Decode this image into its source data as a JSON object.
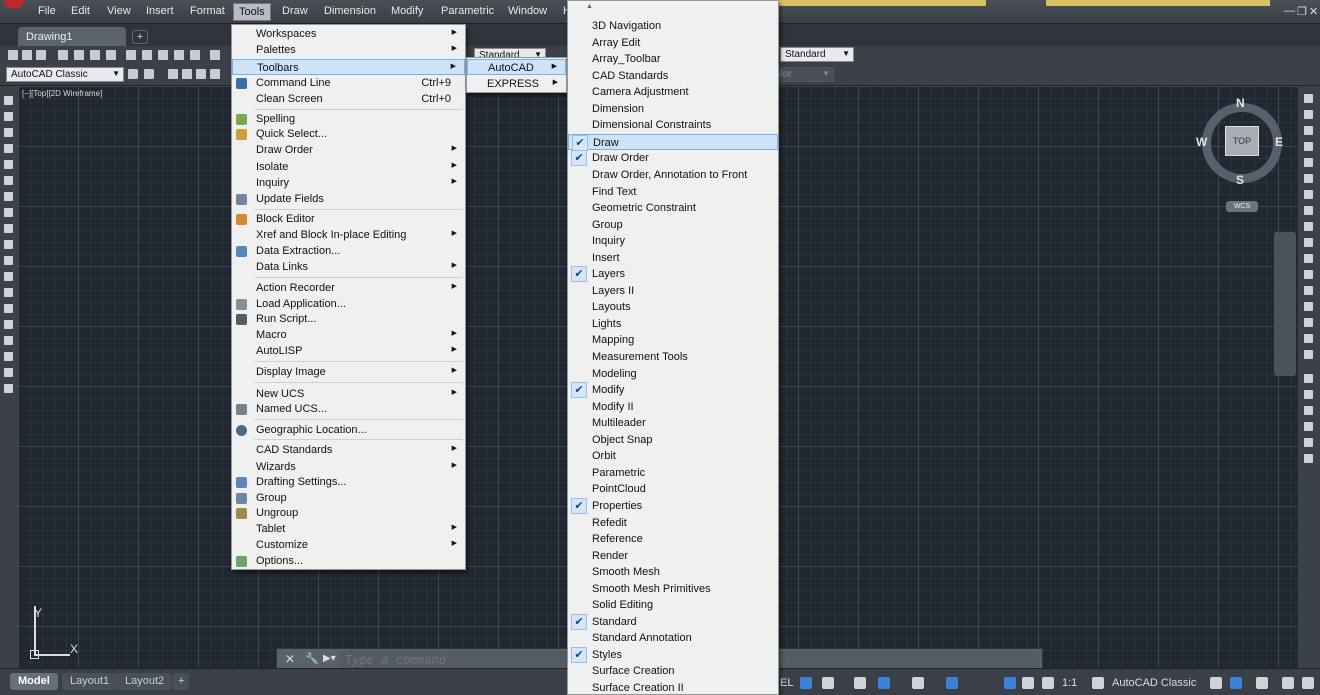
{
  "menubar": {
    "items": [
      "File",
      "Edit",
      "View",
      "Insert",
      "Format",
      "Tools",
      "Draw",
      "Dimension",
      "Modify",
      "Parametric",
      "Window",
      "H"
    ]
  },
  "window_controls": {
    "minimize": "—",
    "restore": "❐",
    "close": "✕"
  },
  "tab": {
    "document": "Drawing1",
    "new_tab": "+"
  },
  "toolbar": {
    "workspace": "AutoCAD Classic",
    "text_style": "Standard",
    "dim_style": "Standard",
    "color": "olor"
  },
  "viewport": {
    "label": "[−][Top][2D Wireframe]"
  },
  "viewcube": {
    "n": "N",
    "s": "S",
    "e": "E",
    "w": "W",
    "top": "TOP",
    "wcs": "WCS"
  },
  "ucs": {
    "x": "X",
    "y": "Y"
  },
  "command": {
    "placeholder": "Type a command",
    "close": "✕",
    "wrench": "🔧",
    "prompt": "▶▾"
  },
  "layout_tabs": [
    "Model",
    "Layout1",
    "Layout2",
    "+"
  ],
  "status": {
    "scale": "1:1",
    "workspace": "AutoCAD Classic",
    "model_label": "EL"
  },
  "tools_menu": {
    "items": [
      {
        "label": "Workspaces",
        "submenu": true
      },
      {
        "label": "Palettes",
        "submenu": true
      },
      {
        "label": "Toolbars",
        "submenu": true
      },
      {
        "label": "Command Line",
        "shortcut": "Ctrl+9"
      },
      {
        "label": "Clean Screen",
        "shortcut": "Ctrl+0"
      },
      {
        "label": "Spelling"
      },
      {
        "label": "Quick Select..."
      },
      {
        "label": "Draw Order",
        "submenu": true
      },
      {
        "label": "Isolate",
        "submenu": true
      },
      {
        "label": "Inquiry",
        "submenu": true
      },
      {
        "label": "Update Fields"
      },
      {
        "label": "Block Editor"
      },
      {
        "label": "Xref and Block In-place Editing",
        "submenu": true
      },
      {
        "label": "Data Extraction..."
      },
      {
        "label": "Data Links",
        "submenu": true
      },
      {
        "label": "Action Recorder",
        "submenu": true
      },
      {
        "label": "Load Application..."
      },
      {
        "label": "Run Script..."
      },
      {
        "label": "Macro",
        "submenu": true
      },
      {
        "label": "AutoLISP",
        "submenu": true
      },
      {
        "label": "Display Image",
        "submenu": true
      },
      {
        "label": "New UCS",
        "submenu": true
      },
      {
        "label": "Named UCS..."
      },
      {
        "label": "Geographic Location..."
      },
      {
        "label": "CAD Standards",
        "submenu": true
      },
      {
        "label": "Wizards",
        "submenu": true
      },
      {
        "label": "Drafting Settings..."
      },
      {
        "label": "Group"
      },
      {
        "label": "Ungroup"
      },
      {
        "label": "Tablet",
        "submenu": true
      },
      {
        "label": "Customize",
        "submenu": true
      },
      {
        "label": "Options..."
      }
    ]
  },
  "toolbars_submenu": {
    "items": [
      "AutoCAD",
      "EXPRESS"
    ]
  },
  "autocad_toolbars": {
    "items": [
      {
        "label": "3D Navigation",
        "checked": false
      },
      {
        "label": "Array Edit",
        "checked": false
      },
      {
        "label": "Array_Toolbar",
        "checked": false
      },
      {
        "label": "CAD Standards",
        "checked": false
      },
      {
        "label": "Camera Adjustment",
        "checked": false
      },
      {
        "label": "Dimension",
        "checked": false
      },
      {
        "label": "Dimensional Constraints",
        "checked": false
      },
      {
        "label": "Draw",
        "checked": true
      },
      {
        "label": "Draw Order",
        "checked": true
      },
      {
        "label": "Draw Order, Annotation to Front",
        "checked": false
      },
      {
        "label": "Find Text",
        "checked": false
      },
      {
        "label": "Geometric Constraint",
        "checked": false
      },
      {
        "label": "Group",
        "checked": false
      },
      {
        "label": "Inquiry",
        "checked": false
      },
      {
        "label": "Insert",
        "checked": false
      },
      {
        "label": "Layers",
        "checked": true
      },
      {
        "label": "Layers II",
        "checked": false
      },
      {
        "label": "Layouts",
        "checked": false
      },
      {
        "label": "Lights",
        "checked": false
      },
      {
        "label": "Mapping",
        "checked": false
      },
      {
        "label": "Measurement Tools",
        "checked": false
      },
      {
        "label": "Modeling",
        "checked": false
      },
      {
        "label": "Modify",
        "checked": true
      },
      {
        "label": "Modify II",
        "checked": false
      },
      {
        "label": "Multileader",
        "checked": false
      },
      {
        "label": "Object Snap",
        "checked": false
      },
      {
        "label": "Orbit",
        "checked": false
      },
      {
        "label": "Parametric",
        "checked": false
      },
      {
        "label": "PointCloud",
        "checked": false
      },
      {
        "label": "Properties",
        "checked": true
      },
      {
        "label": "Refedit",
        "checked": false
      },
      {
        "label": "Reference",
        "checked": false
      },
      {
        "label": "Render",
        "checked": false
      },
      {
        "label": "Smooth Mesh",
        "checked": false
      },
      {
        "label": "Smooth Mesh Primitives",
        "checked": false
      },
      {
        "label": "Solid Editing",
        "checked": false
      },
      {
        "label": "Standard",
        "checked": true
      },
      {
        "label": "Standard Annotation",
        "checked": false
      },
      {
        "label": "Styles",
        "checked": true
      },
      {
        "label": "Surface Creation",
        "checked": false
      },
      {
        "label": "Surface Creation II",
        "checked": false
      }
    ]
  }
}
